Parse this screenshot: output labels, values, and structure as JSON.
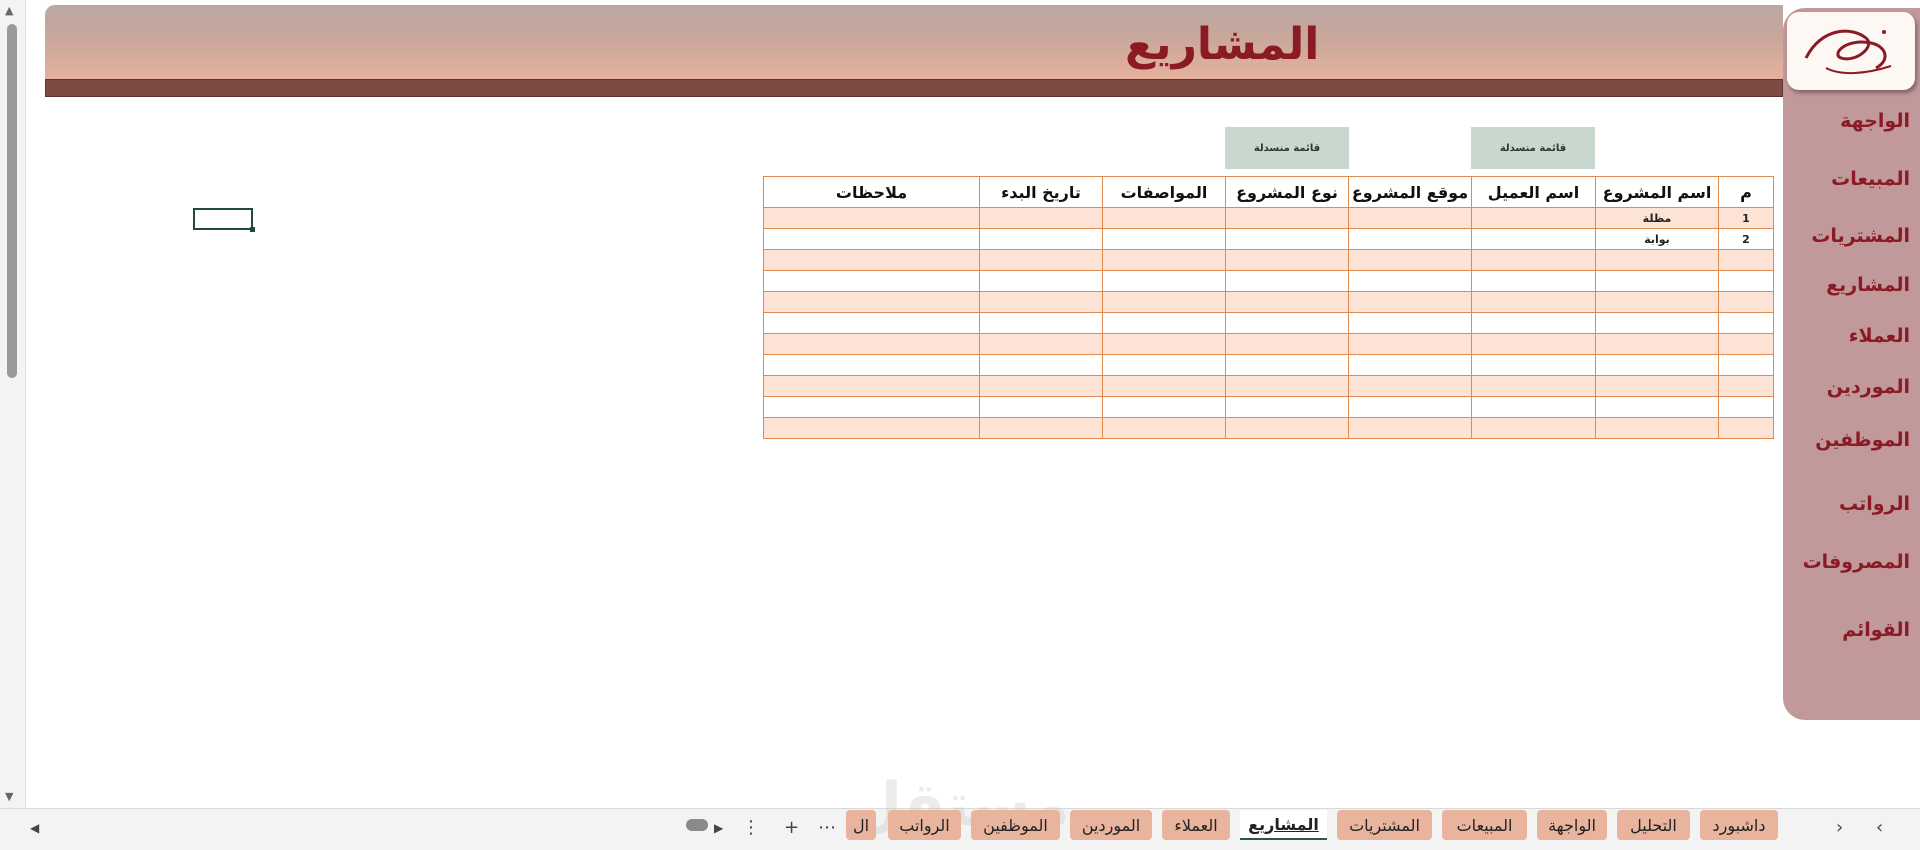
{
  "page": {
    "title": "المشاريع",
    "dropdown_label": "قائمة منسدلة"
  },
  "nav": {
    "items": [
      "الواجهة",
      "المبيعات",
      "المشتريات",
      "المشاريع",
      "العملاء",
      "الموردين",
      "الموظفين",
      "الرواتب",
      "المصروفات",
      "القوائم"
    ]
  },
  "table": {
    "headers": [
      "م",
      "اسم المشروع",
      "اسم العميل",
      "موقع المشروع",
      "نوع المشروع",
      "المواصفات",
      "تاريخ البدء",
      "ملاحظات"
    ],
    "rows": [
      [
        "1",
        "مظلة",
        "",
        "",
        "",
        "",
        "",
        ""
      ],
      [
        "2",
        "بوابة",
        "",
        "",
        "",
        "",
        "",
        ""
      ],
      [
        "",
        "",
        "",
        "",
        "",
        "",
        "",
        ""
      ],
      [
        "",
        "",
        "",
        "",
        "",
        "",
        "",
        ""
      ],
      [
        "",
        "",
        "",
        "",
        "",
        "",
        "",
        ""
      ],
      [
        "",
        "",
        "",
        "",
        "",
        "",
        "",
        ""
      ],
      [
        "",
        "",
        "",
        "",
        "",
        "",
        "",
        ""
      ],
      [
        "",
        "",
        "",
        "",
        "",
        "",
        "",
        ""
      ],
      [
        "",
        "",
        "",
        "",
        "",
        "",
        "",
        ""
      ],
      [
        "",
        "",
        "",
        "",
        "",
        "",
        "",
        ""
      ],
      [
        "",
        "",
        "",
        "",
        "",
        "",
        "",
        ""
      ]
    ]
  },
  "sheet_tabs": {
    "items": [
      "داشبورد",
      "التحليل",
      "الواجهة",
      "المبيعات",
      "المشتريات",
      "المشاريع",
      "العملاء",
      "الموردين",
      "الموظفين",
      "الرواتب",
      "ال"
    ],
    "active": "المشاريع"
  },
  "watermark": "مستقل",
  "colors": {
    "accent": "#8a1a24",
    "nav_bg": "#c2999b",
    "tab_bg": "#e9b49e",
    "row_stripe": "#fde2d6",
    "grid_border": "#e08a4e",
    "dropdown_bg": "#c9d8cf"
  }
}
